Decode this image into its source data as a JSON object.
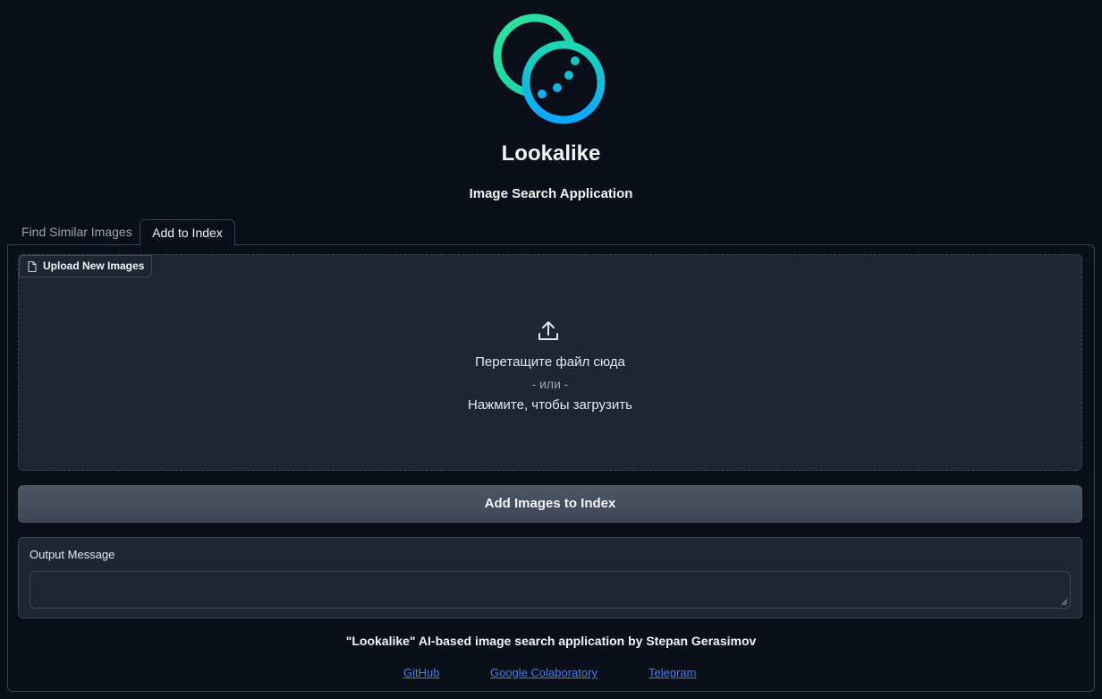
{
  "header": {
    "logo_icon": "lookalike-logo-icon",
    "title": "Lookalike",
    "subtitle": "Image Search Application"
  },
  "tabs": [
    {
      "label": "Find Similar Images",
      "active": false
    },
    {
      "label": "Add to Index",
      "active": true
    }
  ],
  "upload": {
    "label": "Upload New Images",
    "label_icon": "file-icon",
    "icon": "upload-icon",
    "drop_text": "Перетащите файл сюда",
    "or_text": "- или -",
    "click_text": "Нажмите, чтобы загрузить"
  },
  "actions": {
    "add_button_label": "Add Images to Index"
  },
  "output": {
    "label": "Output Message",
    "value": ""
  },
  "footer": {
    "credit": "\"Lookalike\" AI-based image search application by Stepan Gerasimov",
    "links": [
      {
        "label": "GitHub"
      },
      {
        "label": "Google Colaboratory"
      },
      {
        "label": "Telegram"
      }
    ]
  },
  "colors": {
    "background": "#0b0f19",
    "panel": "#1f2533",
    "accent_gradient_start": "#22e6a0",
    "accent_gradient_end": "#0ea5e9",
    "link": "#3b82f6"
  }
}
